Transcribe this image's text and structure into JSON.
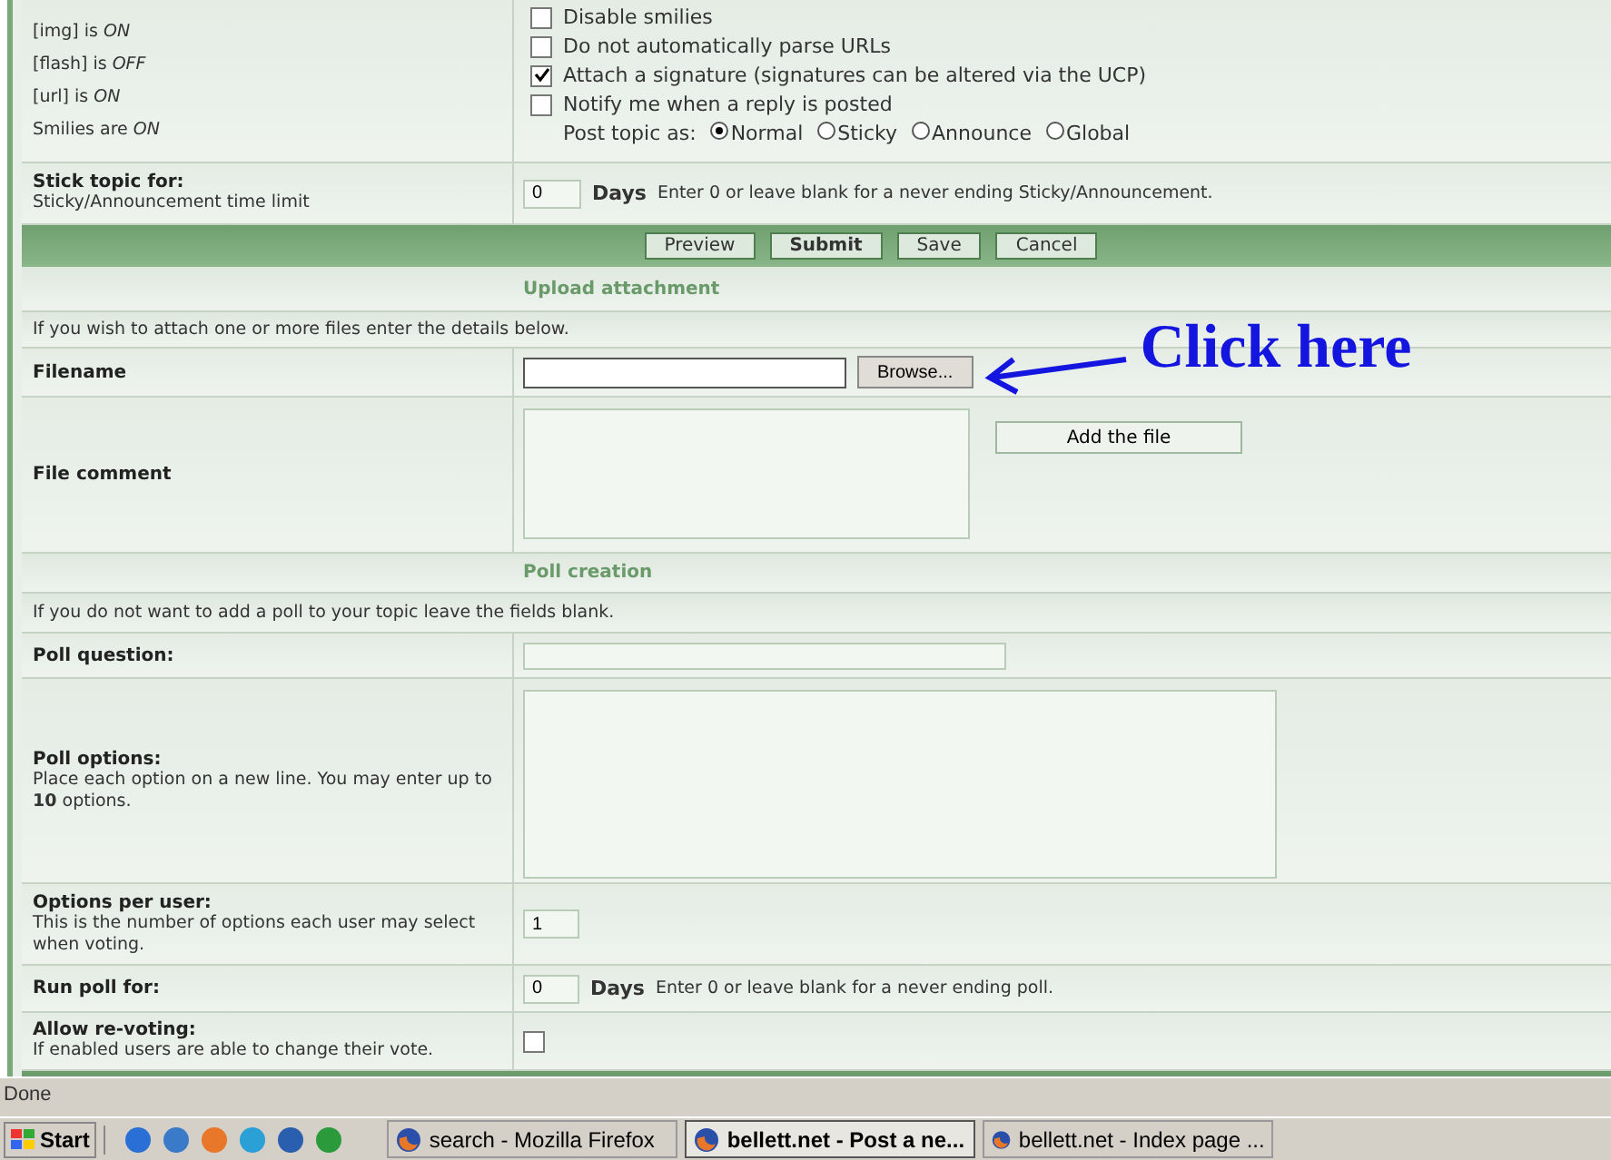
{
  "options_row": {
    "status_lines": [
      "[img] is *ON*",
      "[flash] is *OFF*",
      "[url] is *ON*",
      "Smilies are *ON*"
    ],
    "checkboxes": [
      {
        "label": "Disable smilies",
        "checked": false
      },
      {
        "label": "Do not automatically parse URLs",
        "checked": false
      },
      {
        "label": "Attach a signature (signatures can be altered via the UCP)",
        "checked": true
      },
      {
        "label": "Notify me when a reply is posted",
        "checked": false
      }
    ],
    "post_topic": {
      "label": "Post topic as:",
      "options": [
        {
          "label": "Normal",
          "selected": true
        },
        {
          "label": "Sticky",
          "selected": false
        },
        {
          "label": "Announce",
          "selected": false
        },
        {
          "label": "Global",
          "selected": false
        }
      ]
    }
  },
  "stick_row": {
    "title": "Stick topic for:",
    "explain": "Sticky/Announcement time limit",
    "value": "0",
    "unit": "Days",
    "hint": "Enter 0 or leave blank for a never ending Sticky/Announcement."
  },
  "buttons": [
    {
      "label": "Preview",
      "primary": false
    },
    {
      "label": "Submit",
      "primary": true
    },
    {
      "label": "Save",
      "primary": false
    },
    {
      "label": "Cancel",
      "primary": false
    }
  ],
  "upload": {
    "header": "Upload attachment",
    "info": "If you wish to attach one or more files enter the details below.",
    "filename_label": "Filename",
    "browse": "Browse...",
    "annotation": "Click here",
    "comment_label": "File comment",
    "add_button": "Add the file"
  },
  "poll": {
    "header": "Poll creation",
    "info": "If you do not want to add a poll to your topic leave the fields blank.",
    "question_label": "Poll question:",
    "options_title": "Poll options:",
    "options_explain": "Place each option on a new line. You may enter up to **10** options.",
    "per_user_title": "Options per user:",
    "per_user_explain": "This is the number of options each user may select when voting.",
    "per_user_value": "1",
    "run_title": "Run poll for:",
    "run_value": "0",
    "run_unit": "Days",
    "run_hint": "Enter 0 or leave blank for a never ending poll.",
    "revote_title": "Allow re-voting:",
    "revote_explain": "If enabled users are able to change their vote.",
    "revote_checked": false
  },
  "status_bar": "Done",
  "taskbar": {
    "start": "Start",
    "windows": [
      {
        "label": "search - Mozilla Firefox",
        "selected": false
      },
      {
        "label": "bellett.net - Post a ne...",
        "selected": true
      },
      {
        "label": "bellett.net - Index page ...",
        "selected": false
      }
    ]
  }
}
